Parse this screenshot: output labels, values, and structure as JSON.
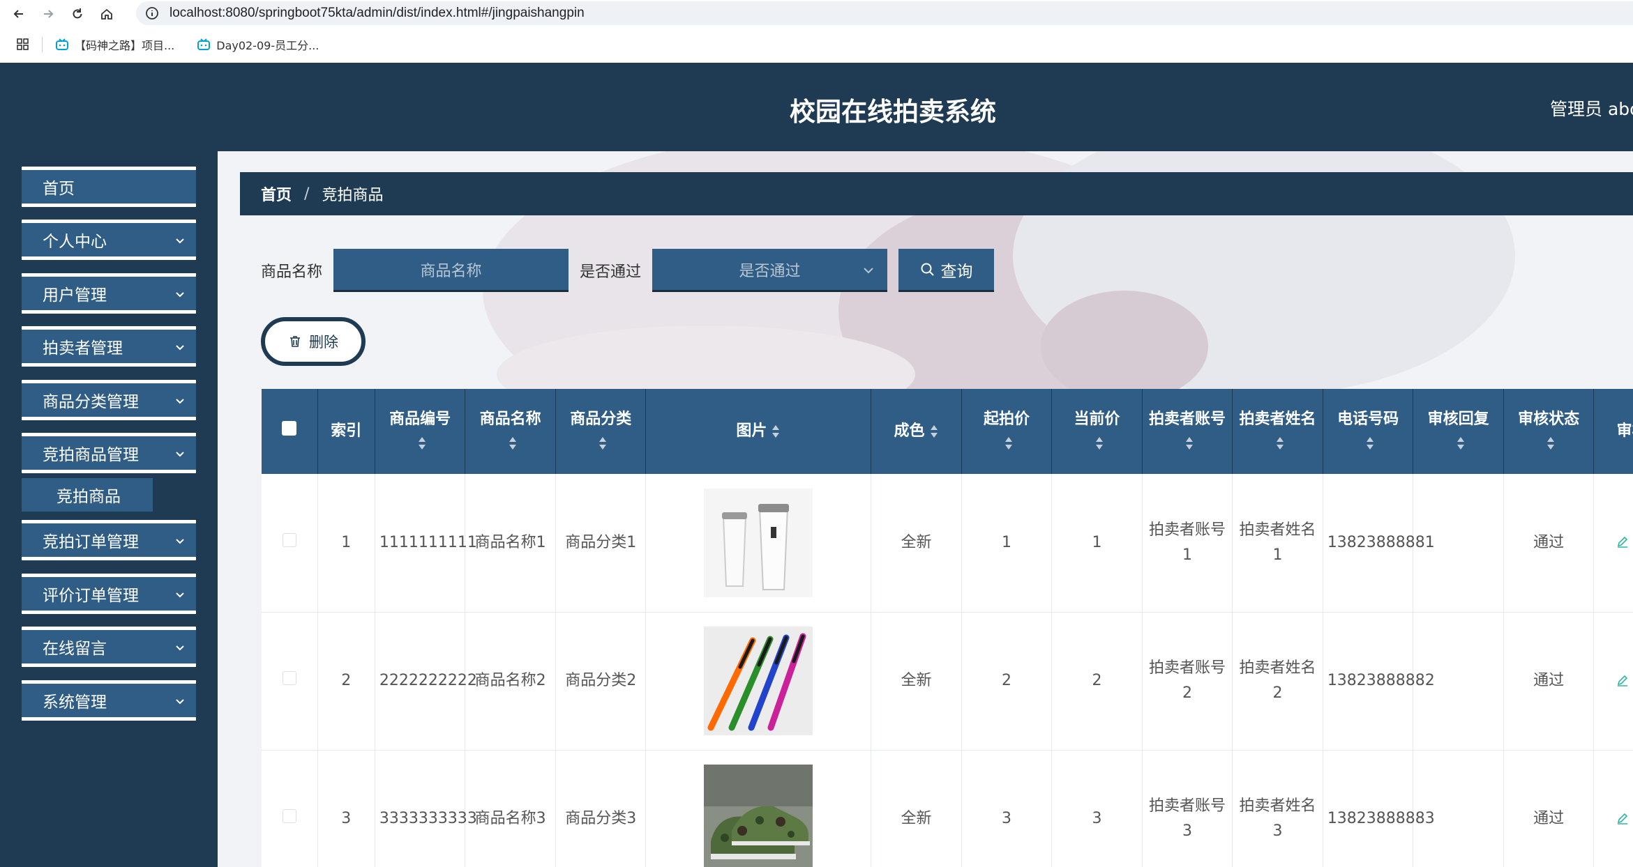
{
  "browser": {
    "url": "localhost:8080/springboot75kta/admin/dist/index.html#/jingpaishangpin",
    "bookmarks": [
      "【码神之路】项目...",
      "Day02-09-员工分..."
    ]
  },
  "header": {
    "title": "校园在线拍卖系统",
    "user": "管理员 abo"
  },
  "sidebar": {
    "items": [
      {
        "label": "首页"
      },
      {
        "label": "个人中心"
      },
      {
        "label": "用户管理"
      },
      {
        "label": "拍卖者管理"
      },
      {
        "label": "商品分类管理"
      },
      {
        "label": "竞拍商品管理"
      },
      {
        "label": "竞拍订单管理"
      },
      {
        "label": "评价订单管理"
      },
      {
        "label": "在线留言"
      },
      {
        "label": "系统管理"
      }
    ],
    "sub_item": "竞拍商品"
  },
  "breadcrumb": {
    "home": "首页",
    "separator": "/",
    "current": "竞拍商品"
  },
  "search": {
    "name_label": "商品名称",
    "name_placeholder": "商品名称",
    "pass_label": "是否通过",
    "pass_placeholder": "是否通过",
    "query_label": "查询"
  },
  "actions": {
    "delete_label": "删除"
  },
  "table": {
    "headers": [
      "索引",
      "商品编号",
      "商品名称",
      "商品分类",
      "图片",
      "成色",
      "起拍价",
      "当前价",
      "拍卖者账号",
      "拍卖者姓名",
      "电话号码",
      "审核回复",
      "审核状态",
      "审核"
    ],
    "rows": [
      {
        "index": "1",
        "code": "1111111111",
        "name": "商品名称1",
        "category": "商品分类1",
        "image": "cups-image",
        "condition": "全新",
        "start_price": "1",
        "current_price": "1",
        "account": "拍卖者账号1",
        "seller": "拍卖者姓名1",
        "phone": "13823888881",
        "reply": "",
        "status": "通过",
        "action": "审核"
      },
      {
        "index": "2",
        "code": "2222222222",
        "name": "商品名称2",
        "category": "商品分类2",
        "image": "toothbrush-image",
        "condition": "全新",
        "start_price": "2",
        "current_price": "2",
        "account": "拍卖者账号2",
        "seller": "拍卖者姓名2",
        "phone": "13823888882",
        "reply": "",
        "status": "通过",
        "action": "审核"
      },
      {
        "index": "3",
        "code": "3333333333",
        "name": "商品名称3",
        "category": "商品分类3",
        "image": "shoes-image",
        "condition": "全新",
        "start_price": "3",
        "current_price": "3",
        "account": "拍卖者账号3",
        "seller": "拍卖者姓名3",
        "phone": "13823888883",
        "reply": "",
        "status": "通过",
        "action": "审核"
      }
    ]
  },
  "colors": {
    "primary_dark": "#1f3b53",
    "primary": "#2f5d85",
    "link": "#2eb6a0"
  }
}
